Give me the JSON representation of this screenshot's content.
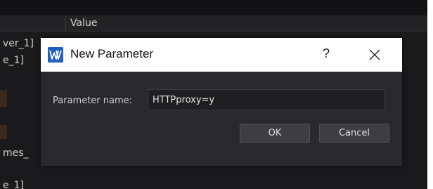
{
  "table": {
    "value_header": "Value",
    "background_items": [
      "ver_1]",
      "e_1]",
      "mes_",
      "e_1]"
    ]
  },
  "dialog": {
    "title": "New Parameter",
    "help_label": "?",
    "param_label": "Parameter name:",
    "param_value": "HTTPproxy=y",
    "ok_label": "OK",
    "cancel_label": "Cancel"
  },
  "colors": {
    "titlebar": "#ffffff",
    "dialog_body": "#29292d",
    "app_background": "#1a1a1c",
    "icon_blue": "#1f5fbf"
  },
  "icons": {
    "app": "app-logo-icon",
    "close": "close-icon"
  }
}
